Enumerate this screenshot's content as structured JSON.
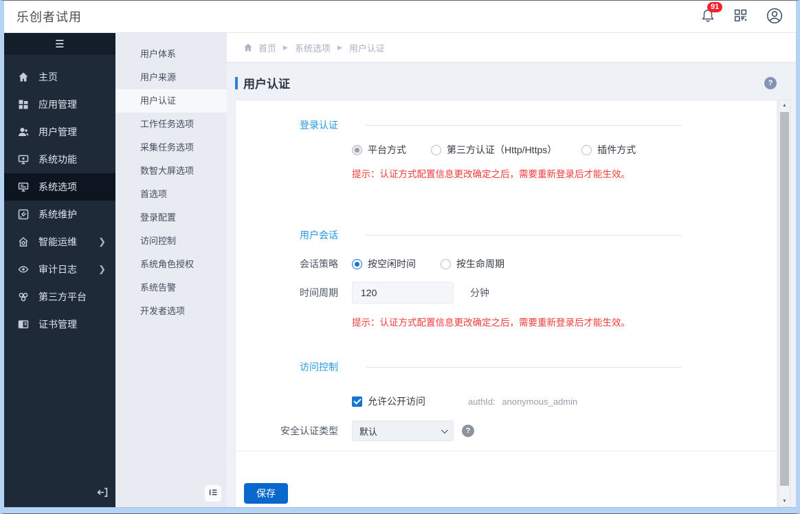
{
  "app": {
    "title": "乐创者试用",
    "notification_count": "91"
  },
  "sidebar": {
    "items": [
      {
        "label": "主页",
        "icon": "home-icon"
      },
      {
        "label": "应用管理",
        "icon": "apps-icon"
      },
      {
        "label": "用户管理",
        "icon": "users-icon"
      },
      {
        "label": "系统功能",
        "icon": "system-functions-icon"
      },
      {
        "label": "系统选项",
        "icon": "system-options-icon",
        "selected": true
      },
      {
        "label": "系统维护",
        "icon": "system-maintenance-icon"
      },
      {
        "label": "智能运维",
        "icon": "smart-ops-icon",
        "expandable": true
      },
      {
        "label": "审计日志",
        "icon": "audit-log-icon",
        "expandable": true
      },
      {
        "label": "第三方平台",
        "icon": "third-party-icon"
      },
      {
        "label": "证书管理",
        "icon": "certificate-icon"
      }
    ]
  },
  "submenu": {
    "items": [
      {
        "label": "用户体系"
      },
      {
        "label": "用户来源"
      },
      {
        "label": "用户认证",
        "selected": true
      },
      {
        "label": "工作任务选项"
      },
      {
        "label": "采集任务选项"
      },
      {
        "label": "数智大屏选项"
      },
      {
        "label": "首选项"
      },
      {
        "label": "登录配置"
      },
      {
        "label": "访问控制"
      },
      {
        "label": "系统角色授权"
      },
      {
        "label": "系统告警"
      },
      {
        "label": "开发者选项"
      }
    ]
  },
  "breadcrumb": {
    "items": [
      "首页",
      "系统选项",
      "用户认证"
    ]
  },
  "page": {
    "title": "用户认证"
  },
  "form": {
    "login_auth": {
      "title": "登录认证",
      "options": [
        {
          "label": "平台方式",
          "selected": true
        },
        {
          "label": "第三方认证（Http/Https）",
          "selected": false
        },
        {
          "label": "插件方式",
          "selected": false
        }
      ],
      "hint": "提示：认证方式配置信息更改确定之后，需要重新登录后才能生效。"
    },
    "user_session": {
      "title": "用户会话",
      "policy_label": "会话策略",
      "policy_options": [
        {
          "label": "按空闲时间",
          "selected": true
        },
        {
          "label": "按生命周期",
          "selected": false
        }
      ],
      "period_label": "时间周期",
      "period_value": "120",
      "period_unit": "分钟",
      "hint": "提示：认证方式配置信息更改确定之后，需要重新登录后才能生效。"
    },
    "access_control": {
      "title": "访问控制",
      "public_access_label": "允许公开访问",
      "public_access_checked": true,
      "auth_id_label": "authId:",
      "auth_id_value": "anonymous_admin",
      "auth_type_label": "安全认证类型",
      "auth_type_value": "默认"
    },
    "save_label": "保存"
  },
  "colors": {
    "accent_blue": "#2e7fd6",
    "section_blue": "#2898e0",
    "save_blue": "#0a67cc",
    "badge_red": "#f5222d",
    "hint_red": "#f23b3b",
    "sidebar_dark": "#1e2a38"
  }
}
